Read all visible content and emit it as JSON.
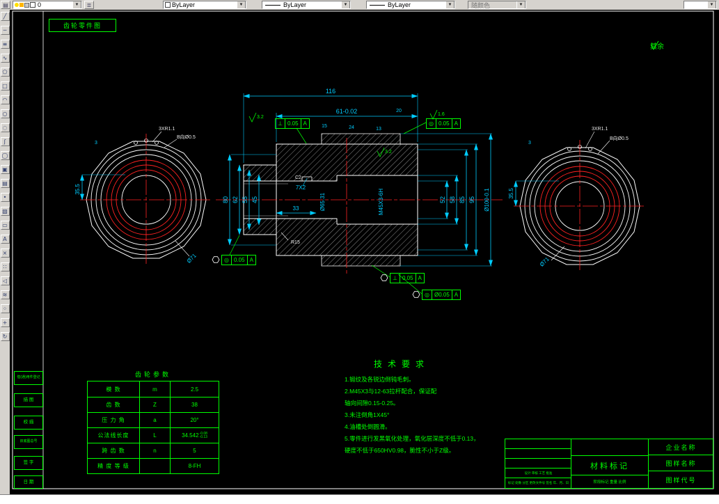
{
  "colors": {
    "background": "#000000",
    "geometry": "#ffffff",
    "dimension": "#00ccff",
    "annotation": "#00ff00",
    "centerline": "#ff2222",
    "toolbar_bg": "#d6d3ce"
  },
  "toolbar": {
    "layer_value": "0",
    "color_value": "ByLayer",
    "linetype_value": "ByLayer",
    "lineweight_value": "ByLayer",
    "plot_style_value": "随颜色"
  },
  "tools": [
    {
      "name": "line",
      "glyph": "╱"
    },
    {
      "name": "xline",
      "glyph": "─"
    },
    {
      "name": "mline",
      "glyph": "≡"
    },
    {
      "name": "pline",
      "glyph": "∿"
    },
    {
      "name": "polygon",
      "glyph": "⬠"
    },
    {
      "name": "rectangle",
      "glyph": "□"
    },
    {
      "name": "arc",
      "glyph": "◠"
    },
    {
      "name": "circle",
      "glyph": "○"
    },
    {
      "name": "revcloud",
      "glyph": "◌"
    },
    {
      "name": "spline",
      "glyph": "ʃ"
    },
    {
      "name": "ellipse",
      "glyph": "◯"
    },
    {
      "name": "insert-block",
      "glyph": "▣"
    },
    {
      "name": "make-block",
      "glyph": "▤"
    },
    {
      "name": "point",
      "glyph": "•"
    },
    {
      "name": "hatch",
      "glyph": "▧"
    },
    {
      "name": "region",
      "glyph": "▭"
    },
    {
      "name": "mtext",
      "glyph": "A"
    },
    {
      "name": "erase",
      "glyph": "×"
    },
    {
      "name": "copy",
      "glyph": "∷"
    },
    {
      "name": "mirror",
      "glyph": "◁"
    },
    {
      "name": "offset",
      "glyph": "≋"
    },
    {
      "name": "array",
      "glyph": "⁘"
    },
    {
      "name": "move",
      "glyph": "+"
    },
    {
      "name": "rotate",
      "glyph": "↻"
    }
  ],
  "drawing": {
    "corner_label": "齿轮零件图",
    "surface_note": "其余",
    "dims": {
      "d116": "116",
      "d61": "61-0.02",
      "d15": "15",
      "d24": "24",
      "d13": "13",
      "d20": "20",
      "d80": "80",
      "d62": "62",
      "d55": "55",
      "d45": "45",
      "d33": "33",
      "d7x2": "7X2",
      "bore": "Ø65.31",
      "thread": "M45X3-6H",
      "d52": "52",
      "d58": "58",
      "d85": "85",
      "d95": "95",
      "od": "Ø100-0.1",
      "g35l": "35.5",
      "g3l": "3",
      "g35r": "35.5",
      "g3r": "3",
      "d71l": "Ø71",
      "d71r": "Ø71"
    },
    "labels": {
      "r15": "R15",
      "c2": "C2",
      "holes_l": "3XR1.1",
      "bhole_l": "B向Ø0.5",
      "holes_r": "3XR1.1",
      "bhole_r": "B向Ø0.5"
    },
    "gdt": [
      {
        "sym": "⊥",
        "val": "0.05",
        "datum": "A"
      },
      {
        "sym": "◎",
        "val": "0.05",
        "datum": "A"
      },
      {
        "sym": "◎",
        "val": "0.05",
        "datum": "A"
      },
      {
        "sym": "⊥",
        "val": "0.05",
        "datum": "A"
      },
      {
        "sym": "◎",
        "val": "Ø0.05",
        "datum": "A"
      }
    ],
    "roughness": [
      "3.2",
      "1.6",
      "3.2"
    ]
  },
  "gear_table": {
    "title": "齿轮参数",
    "rows": [
      {
        "label": "模  数",
        "sym": "m",
        "val": "2.5"
      },
      {
        "label": "齿  数",
        "sym": "Z",
        "val": "38"
      },
      {
        "label": "压 力 角",
        "sym": "a",
        "val": "20°"
      },
      {
        "label": "公法线长度",
        "sym": "L",
        "val": "34.542",
        "tol_top": "-0.08",
        "tol_bot": "-0.13"
      },
      {
        "label": "跨 齿 数",
        "sym": "n",
        "val": "5"
      },
      {
        "label": "精 度 等 级",
        "sym": "",
        "val": "8-FH"
      }
    ]
  },
  "tech": {
    "title": "技术要求",
    "lines": [
      "1.锻纹及各锐边倒钝毛刺。",
      "2.M45X3与12-63拉杆配合，保证配",
      "轴向间隙0.15-0.25。",
      "3.未注倒角1X45°",
      "4.油槽处倒圆滑。",
      "5.零件进行发黑氧化处理，氧化层深度不低于0.13，",
      "硬度不低于650HV0.98，脆性不小于Z级。"
    ]
  },
  "titleblock": {
    "material": "材料标记",
    "company": "企业名称",
    "name": "图样名称",
    "code": "图样代号",
    "change_row": "标记 处数 分区 更改文件号 签名 年、月、日",
    "sign_row": "设计  审核  工艺  批准",
    "stage_row": "阶段标记  重量  比例"
  },
  "margin_boxes": [
    "借(通)用件登记",
    "描 图",
    "校 描",
    "旧底图总号",
    "签 字",
    "日 期"
  ]
}
